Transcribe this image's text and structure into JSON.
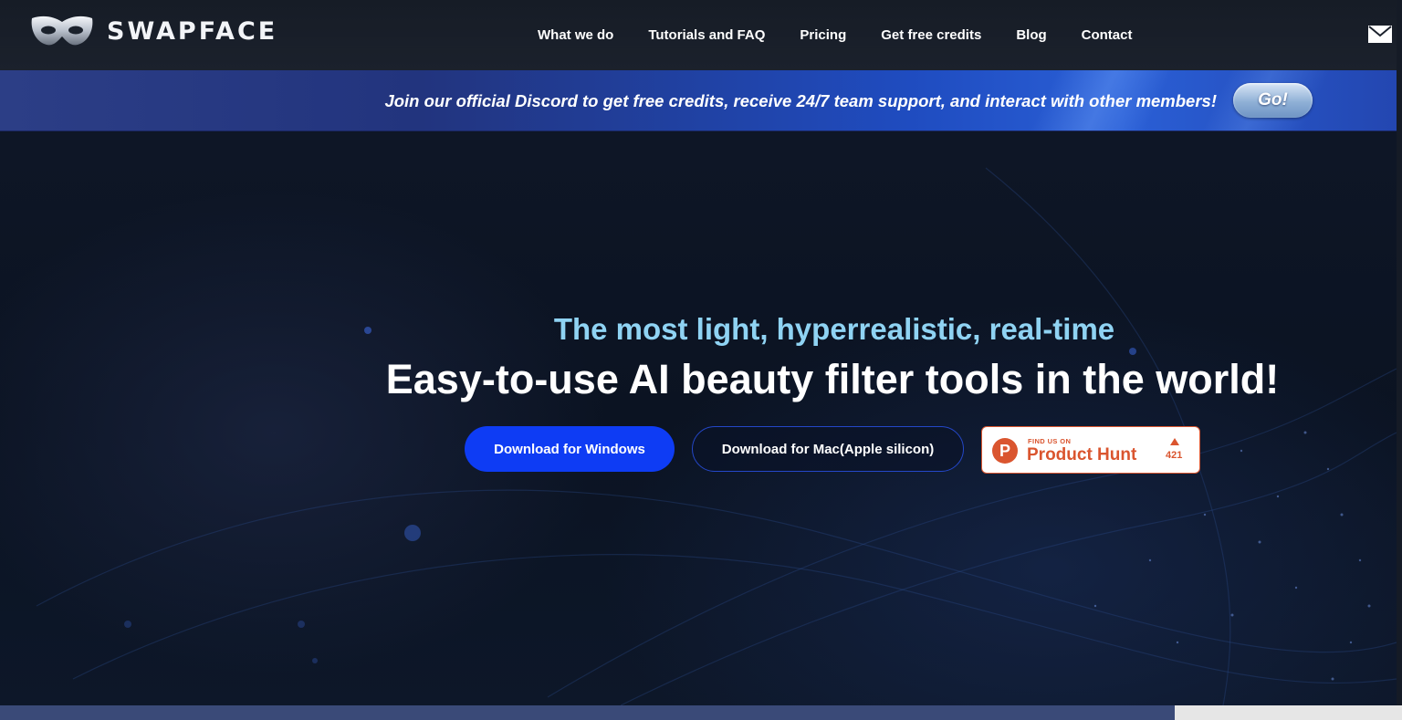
{
  "header": {
    "brand": "SWAPFACE",
    "nav": [
      {
        "label": "What we do"
      },
      {
        "label": "Tutorials and FAQ"
      },
      {
        "label": "Pricing"
      },
      {
        "label": "Get free credits"
      },
      {
        "label": "Blog"
      },
      {
        "label": "Contact"
      }
    ],
    "mail_icon": "mail-icon"
  },
  "banner": {
    "text": "Join our official Discord to get free credits, receive 24/7 team support, and interact with other members!",
    "button_label": "Go!"
  },
  "hero": {
    "subtitle": "The most light, hyperrealistic, real-time",
    "title": "Easy-to-use AI beauty filter tools in the world!",
    "download_windows_label": "Download for Windows",
    "download_mac_label": "Download for Mac(Apple silicon)",
    "product_hunt": {
      "small_label": "FIND US ON",
      "name": "Product Hunt",
      "logo_letter": "P",
      "upvotes": "421"
    }
  },
  "colors": {
    "accent_blue": "#0e3cf4",
    "subtitle_cyan": "#8fd3f3",
    "product_hunt_orange": "#da552f",
    "header_bg": "#1b212c"
  }
}
